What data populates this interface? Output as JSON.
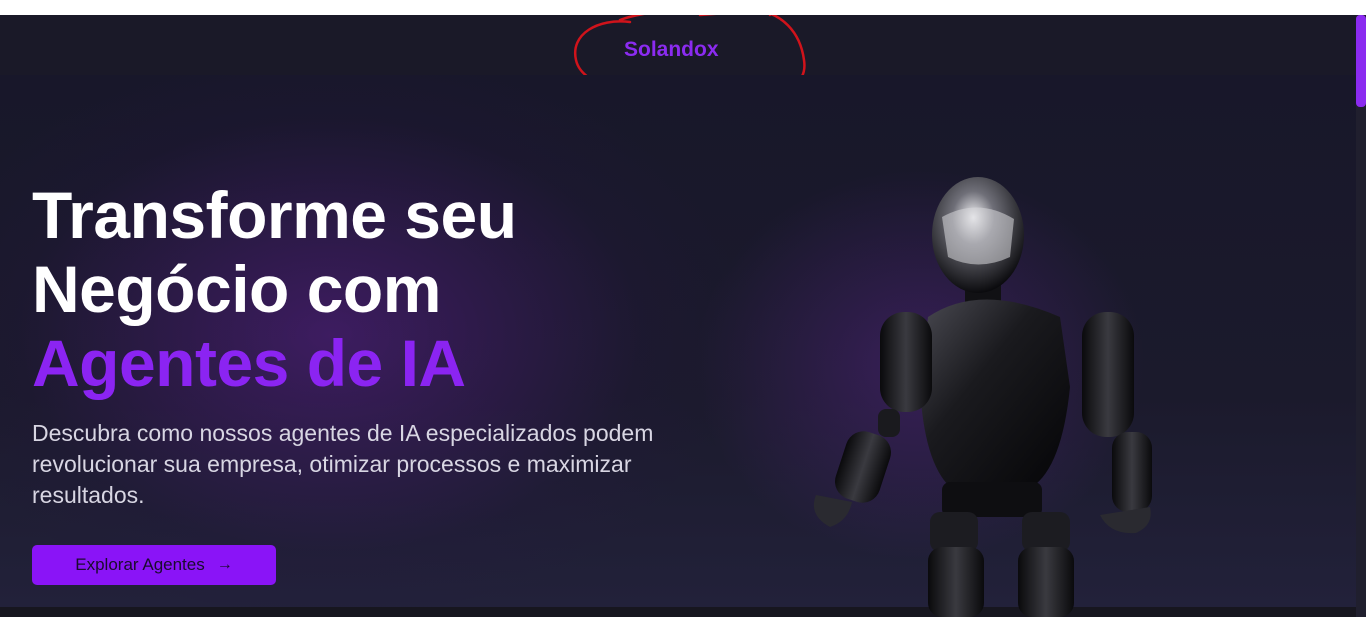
{
  "header": {
    "brand": "Solandox"
  },
  "hero": {
    "headline_line1": "Transforme seu",
    "headline_line2": "Negócio com",
    "headline_accent": "Agentes de IA",
    "subtitle": "Descubra como nossos agentes de IA especializados podem revolucionar sua empresa, otimizar processos e maximizar resultados.",
    "cta_label": "Explorar Agentes",
    "cta_icon": "arrow-right-icon",
    "image": "humanoid-robot-illustration"
  },
  "colors": {
    "background": "#17161f",
    "accent": "#8b24f2",
    "button": "#8a14f7",
    "annotation": "#d0131b"
  }
}
